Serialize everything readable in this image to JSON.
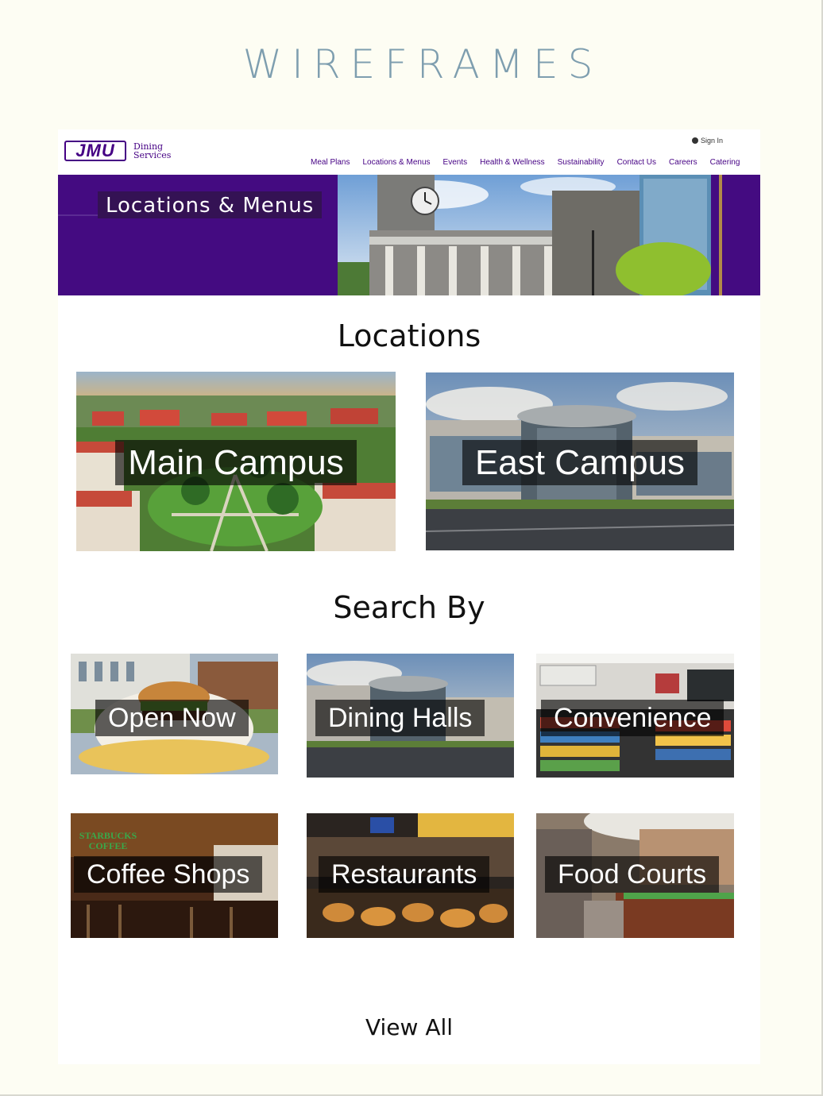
{
  "doc_title": "WIREFRAMES",
  "header": {
    "logo_mark": "JMU",
    "logo_line1": "Dining",
    "logo_line2": "Services",
    "sign_in": "Sign In",
    "nav": [
      "Meal Plans",
      "Locations & Menus",
      "Events",
      "Health & Wellness",
      "Sustainability",
      "Contact Us",
      "Careers",
      "Catering"
    ]
  },
  "hero": {
    "title": "Locations & Menus"
  },
  "locations": {
    "heading": "Locations",
    "tiles": [
      {
        "label": "Main Campus",
        "image": "aerial-campus-photo"
      },
      {
        "label": "East Campus",
        "image": "modern-building-photo"
      }
    ]
  },
  "search_by": {
    "heading": "Search By",
    "tiles": [
      {
        "label": "Open Now",
        "image": "burger-fries-photo"
      },
      {
        "label": "Dining Halls",
        "image": "dining-hall-building-photo"
      },
      {
        "label": "Convenience",
        "image": "convenience-store-photo"
      },
      {
        "label": "Coffee Shops",
        "image": "starbucks-coffee-photo"
      },
      {
        "label": "Restaurants",
        "image": "bakery-case-photo"
      },
      {
        "label": "Food Courts",
        "image": "food-court-photo"
      }
    ],
    "starbucks_sign": "STARBUCKS COFFEE"
  },
  "view_all": "View All",
  "colors": {
    "brand_purple": "#450084",
    "title_blue": "#7e9eaf",
    "page_bg": "#fdfdf3"
  }
}
